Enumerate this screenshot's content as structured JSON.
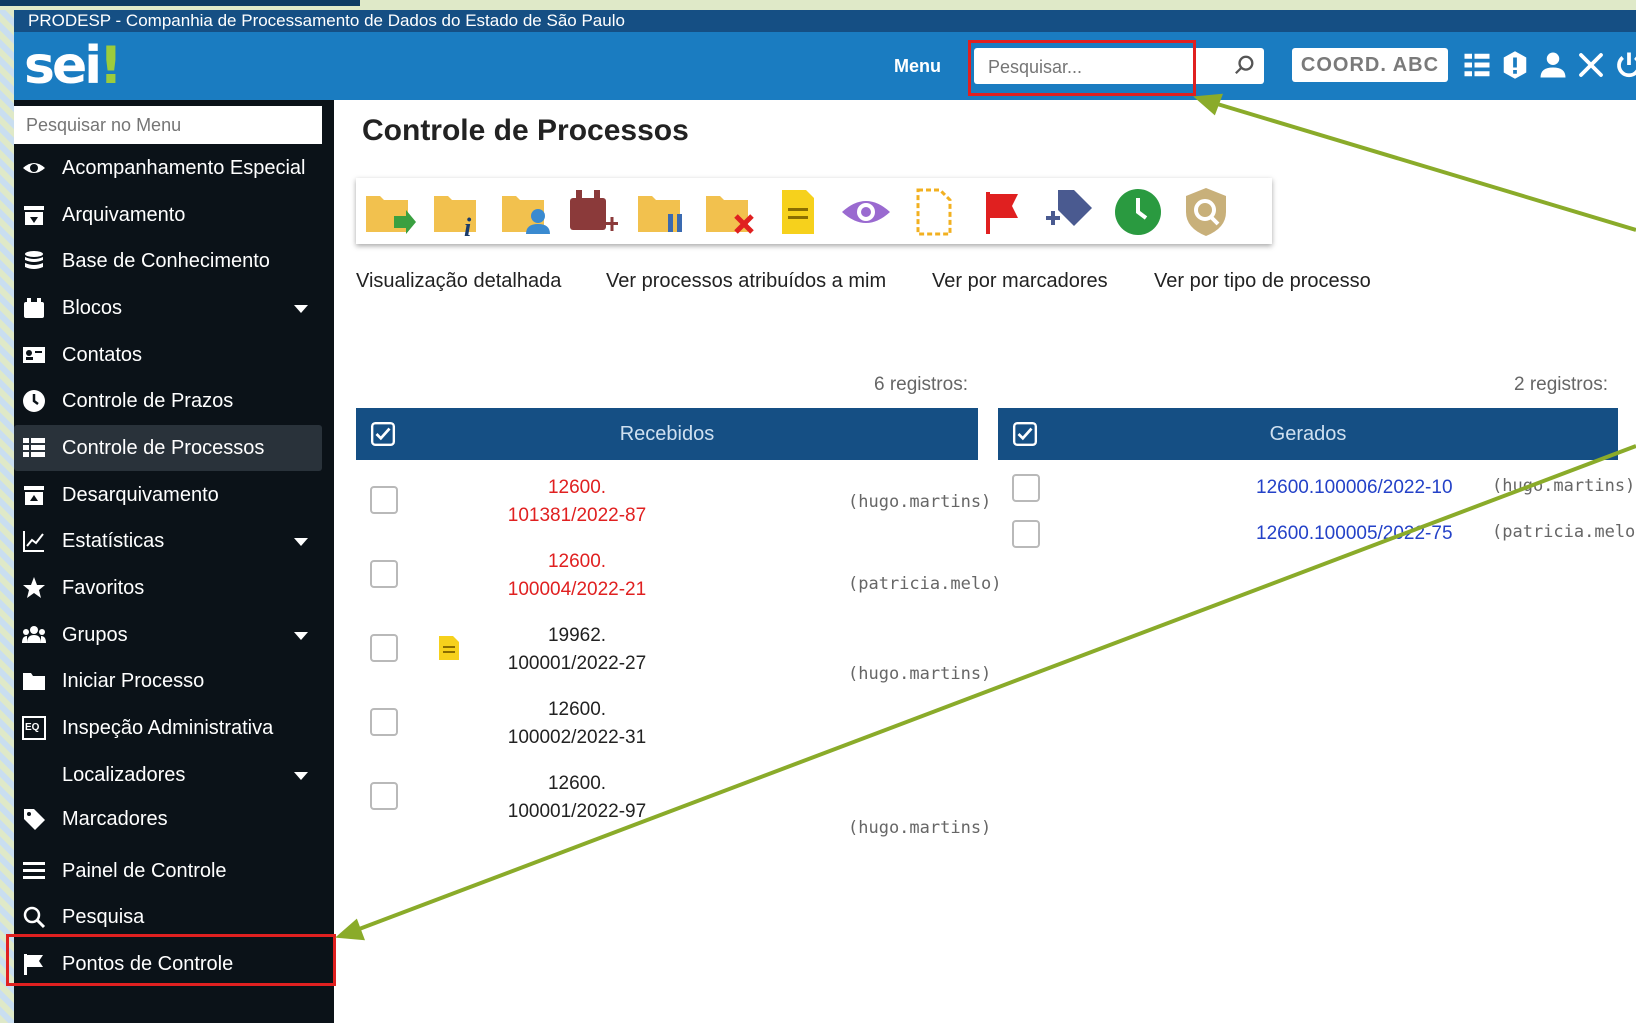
{
  "org_bar": {
    "text": "PRODESP - Companhia de Processamento de Dados do Estado de São Paulo"
  },
  "header": {
    "logo_main": "sei",
    "logo_bang": "!",
    "menu_label": "Menu",
    "search_placeholder": "Pesquisar...",
    "unit": "COORD. ABC",
    "icons": [
      "grid-icon",
      "alert-icon",
      "user-icon",
      "tools-icon",
      "power-icon"
    ]
  },
  "sidebar": {
    "search_placeholder": "Pesquisar no Menu",
    "items": [
      {
        "label": "Acompanhamento Especial",
        "icon": "eye-icon"
      },
      {
        "label": "Arquivamento",
        "icon": "archive-icon"
      },
      {
        "label": "Base de Conhecimento",
        "icon": "database-icon"
      },
      {
        "label": "Blocos",
        "icon": "blocks-icon",
        "caret": true
      },
      {
        "label": "Contatos",
        "icon": "contact-card-icon"
      },
      {
        "label": "Controle de Prazos",
        "icon": "clock-icon"
      },
      {
        "label": "Controle de Processos",
        "icon": "list-icon",
        "active": true
      },
      {
        "label": "Desarquivamento",
        "icon": "unarchive-icon"
      },
      {
        "label": "Estatísticas",
        "icon": "chart-line-icon",
        "caret": true
      },
      {
        "label": "Favoritos",
        "icon": "star-icon"
      },
      {
        "label": "Grupos",
        "icon": "group-icon",
        "caret": true
      },
      {
        "label": "Iniciar Processo",
        "icon": "folder-icon"
      },
      {
        "label": "Inspeção Administrativa",
        "icon": "inspect-icon"
      },
      {
        "label": "Localizadores",
        "icon": "",
        "caret": true
      },
      {
        "label": "Marcadores",
        "icon": "tag-icon"
      },
      {
        "label": "Painel de Controle",
        "icon": "panel-icon"
      },
      {
        "label": "Pesquisa",
        "icon": "search-icon"
      },
      {
        "label": "Pontos de Controle",
        "icon": "flag-icon"
      }
    ]
  },
  "main": {
    "title": "Controle de Processos",
    "toolbar_icons": [
      "send-folder-icon",
      "info-folder-icon",
      "assign-folder-icon",
      "add-block-icon",
      "suspend-folder-icon",
      "close-folder-icon",
      "note-icon",
      "eye-icon",
      "dashed-doc-icon",
      "flag-icon",
      "tag-add-icon",
      "clock-icon",
      "shield-search-icon"
    ],
    "links": [
      "Visualização detalhada",
      "Ver processos atribuídos a mim",
      "Ver por marcadores",
      "Ver por tipo de processo"
    ],
    "received": {
      "count": "6 registros:",
      "header": "Recebidos",
      "rows": [
        {
          "line1": "12600.",
          "line2": "101381/2022-87",
          "user": "(hugo.martins)",
          "color": "red"
        },
        {
          "line1": "12600.",
          "line2": "100004/2022-21",
          "user": "(patricia.melo)",
          "color": "red"
        },
        {
          "line1": "19962.",
          "line2": "100001/2022-27",
          "user": "(hugo.martins)",
          "color": "black"
        },
        {
          "line1": "12600.",
          "line2": "100002/2022-31",
          "user": "",
          "color": "black"
        },
        {
          "line1": "12600.",
          "line2": "100001/2022-97",
          "user": "(hugo.martins)",
          "color": "black"
        }
      ]
    },
    "generated": {
      "count": "2 registros:",
      "header": "Gerados",
      "rows": [
        {
          "process": "12600.100006/2022-10",
          "user": "(hugo.martins)"
        },
        {
          "process": "12600.100005/2022-75",
          "user": "(patricia.melo)"
        }
      ]
    }
  },
  "colors": {
    "header_blue": "#1a7cc1",
    "dark_blue": "#154f84",
    "sidebar": "#0b1218",
    "highlight_red": "#e02020",
    "arrow_green": "#8aab2a"
  }
}
